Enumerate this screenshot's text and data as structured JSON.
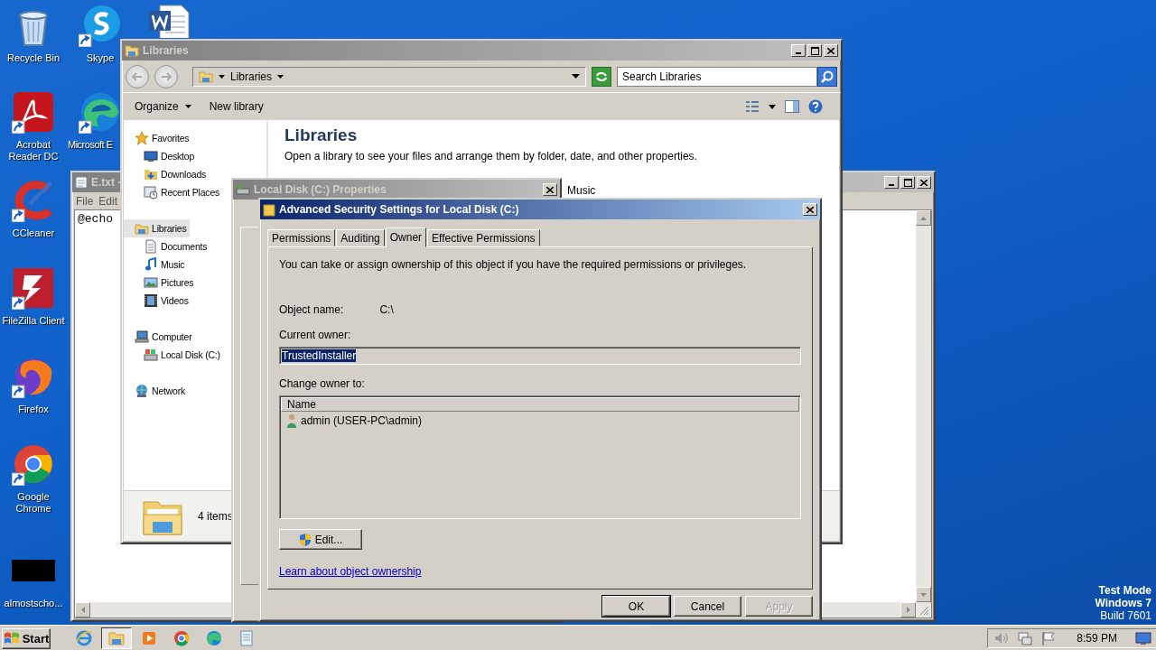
{
  "desktop_icons": [
    {
      "label": "Recycle Bin",
      "kind": "trash"
    },
    {
      "label": "Skype",
      "kind": "chat"
    },
    {
      "kind": "doc"
    },
    {
      "label": "Acrobat Reader DC",
      "kind": "pdf"
    },
    {
      "label": "Microsoft E",
      "kind": "edge"
    },
    {
      "label": "CCleaner",
      "kind": "brush"
    },
    {
      "label": "FileZilla Client",
      "kind": "ftp"
    },
    {
      "label": "Firefox",
      "kind": "fox"
    },
    {
      "label": "Google Chrome",
      "kind": "chrome"
    },
    {
      "label": "almostscho...",
      "kind": "black"
    }
  ],
  "notepad": {
    "title": "E.txt -",
    "menu": [
      "File",
      "Edit"
    ],
    "text": "@echo"
  },
  "explorer": {
    "title": "Libraries",
    "breadcrumb": "Libraries",
    "search": {
      "placeholder": "Search Libraries"
    },
    "toolbar": [
      "Organize",
      "New library"
    ],
    "nav": [
      {
        "label": "Favorites",
        "kind": "star",
        "selected": false,
        "children": [
          {
            "label": "Desktop",
            "kind": "desktop",
            "selected": false
          },
          {
            "label": "Downloads",
            "kind": "download",
            "selected": false
          },
          {
            "label": "Recent Places",
            "kind": "recent",
            "selected": false
          }
        ]
      },
      {
        "label": "Libraries",
        "kind": "library",
        "selected": true,
        "children": [
          {
            "label": "Documents",
            "kind": "document",
            "selected": false
          },
          {
            "label": "Music",
            "kind": "music",
            "selected": false
          },
          {
            "label": "Pictures",
            "kind": "picture",
            "selected": false
          },
          {
            "label": "Videos",
            "kind": "video",
            "selected": false
          }
        ]
      },
      {
        "label": "Computer",
        "kind": "computer",
        "selected": false,
        "children": [
          {
            "label": "Local Disk (C:)",
            "kind": "disk",
            "selected": false
          }
        ]
      },
      {
        "label": "Network",
        "kind": "network",
        "selected": false
      }
    ],
    "heading": "Libraries",
    "description": "Open a library to see your files and arrange them by folder, date, and other properties.",
    "libraries": [
      "Music"
    ],
    "status": "4 items"
  },
  "properties": {
    "title": "Local Disk (C:) Properties"
  },
  "advanced": {
    "title": "Advanced Security Settings for Local Disk (C:)",
    "tabs": [
      {
        "label": "Permissions",
        "selected": false
      },
      {
        "label": "Auditing",
        "selected": false
      },
      {
        "label": "Owner",
        "selected": true
      },
      {
        "label": "Effective Permissions",
        "selected": false
      }
    ],
    "intro": "You can take or assign ownership of this object if you have the required permissions or privileges.",
    "object_label": "Object name:",
    "object_value": "C:\\",
    "current_owner_label": "Current owner:",
    "current_owner": {
      "value": "TrustedInstaller",
      "text_selected": true
    },
    "change_label": "Change owner to:",
    "column": "Name",
    "owners": [
      {
        "name": "admin (USER-PC\\admin)",
        "selected": false
      }
    ],
    "edit_button": "Edit...",
    "link": "Learn about object ownership",
    "buttons": [
      {
        "label": "OK",
        "disabled": false
      },
      {
        "label": "Cancel",
        "disabled": false
      },
      {
        "label": "Apply",
        "disabled": true
      }
    ]
  },
  "os_notice": [
    "Test Mode",
    "Windows 7",
    "Build 7601"
  ],
  "taskbar": {
    "start": "Start",
    "apps": [
      {
        "kind": "ie",
        "active": false
      },
      {
        "kind": "folder",
        "active": true
      },
      {
        "kind": "media",
        "active": false
      },
      {
        "kind": "chrome",
        "active": false
      },
      {
        "kind": "edge",
        "active": false
      },
      {
        "kind": "notepad",
        "active": false
      }
    ],
    "clock": "8:59 PM"
  }
}
